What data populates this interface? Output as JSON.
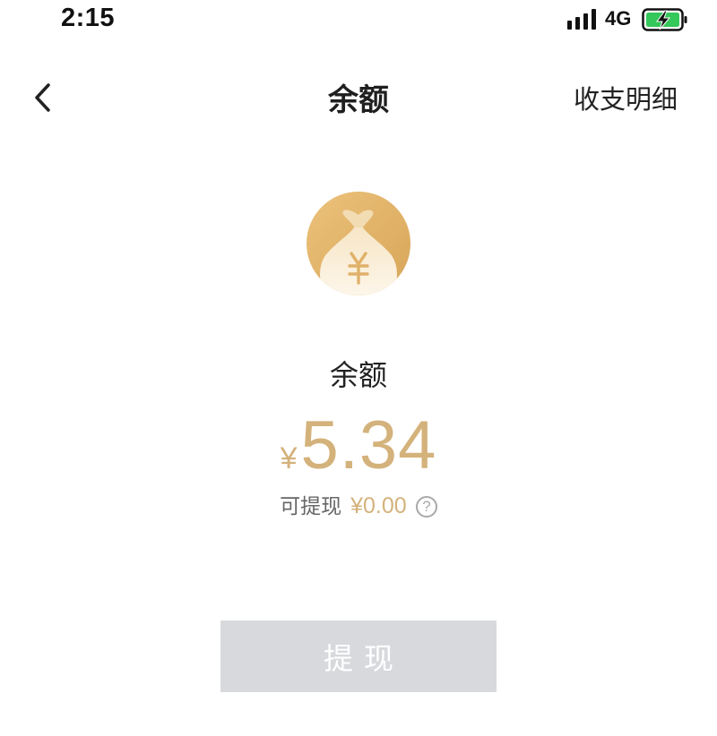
{
  "status_bar": {
    "time": "2:15",
    "network": "4G",
    "icons": [
      "signal-icon",
      "battery-charging-icon"
    ]
  },
  "nav": {
    "back_icon": "chevron-left-icon",
    "title": "余额",
    "action_label": "收支明细"
  },
  "balance": {
    "icon": "money-bag-icon",
    "label": "余额",
    "currency": "¥",
    "amount": "5.34",
    "withdrawable_label": "可提现",
    "withdrawable_value": "¥0.00",
    "help_glyph": "?"
  },
  "actions": {
    "withdraw_label": "提现"
  },
  "colors": {
    "accent_gold": "#d4b27b",
    "button_disabled": "#d7d9dd",
    "battery_green": "#34c759"
  }
}
